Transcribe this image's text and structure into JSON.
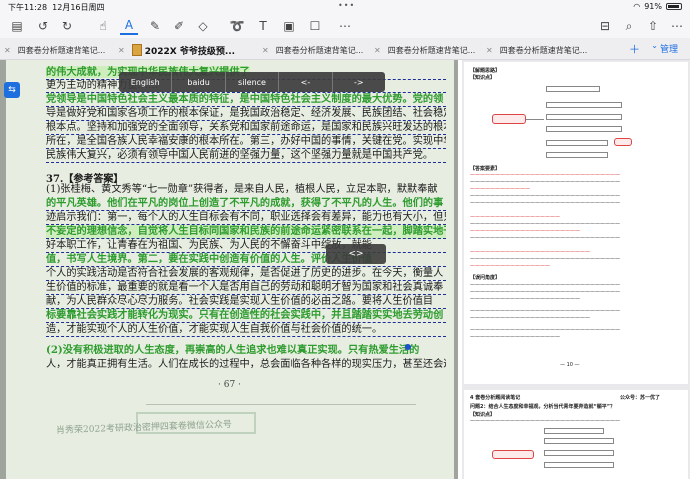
{
  "status": {
    "time": "下午11:28",
    "date": "12月16日周四",
    "battery": "91%"
  },
  "toolbar": {
    "icons": [
      "sidebar-icon",
      "undo-icon",
      "redo-icon",
      "pointer-icon",
      "text-tool-icon",
      "pen-icon",
      "highlighter-icon",
      "eraser-icon",
      "lasso-icon",
      "textbox-icon",
      "image-icon",
      "shape-icon",
      "more-icon",
      "bookmark-icon",
      "search-icon",
      "share-icon",
      "more-menu-icon"
    ]
  },
  "tabs": [
    {
      "label": "四套卷分析题速背笔记..."
    },
    {
      "label": "2022X 爷爷技级预..."
    },
    {
      "label": "四套卷分析题速背笔记..."
    },
    {
      "label": "四套卷分析题速背笔记..."
    },
    {
      "label": "四套卷分析题速背笔记..."
    }
  ],
  "tab_manage": "管理",
  "translate_popup": [
    "English",
    "baidu",
    "silence",
    "<-",
    "->"
  ],
  "toggle_label": "<>",
  "document": {
    "lines": [
      "的伟大成就，为实现中华民族伟大复兴提供了",
      "更为主动的精神力量……",
      "党领导是中国特色社会主义最本质的特征，是中国特色社会主义制度的最大优势。党的领",
      "导是做好党和国家各项工作的根本保证，是我国政治稳定、经济发展、民族团结、社会稳定的",
      "根本点。坚持和加强党的全面领导，关系党和国家前途命运，是国家和民族兴旺发达的根本",
      "所在，是全国各族人民幸福安康的根本所在。第三，办好中国的事情，关键在党。实现中华",
      "民族伟大复兴，必须有领导中国人民前进的坚强力量，这个坚强力量就是中国共产党。"
    ],
    "question": "37.【参考答案】",
    "answer_lines": [
      "(1)张桂梅、黄文秀等“七一勋章”获得者，是来自人民，植根人民，立足本职，默默奉献",
      "的平凡英雄。他们在平凡的岗位上创造了不平凡的成就，获得了不平凡的人生。他们的事",
      "迹启示我们：第一，每个人的人生目标会有不同，职业选择会有差异，能力也有大小，但只要",
      "不妄定的理想信念，自觉将人生目标同国家和民族的前途命运紧密联系在一起，脚踏实地干",
      "好本职工作，让青春在为祖国、为民族、为人民的不懈奋斗中绽放，就能",
      "值，书写人生境界。第二，要在实践中创造有价值的人生。评价人生价值",
      "个人的实践活动是否符合社会发展的客观规律，是否促进了历史的进步。在今天，衡量人",
      "生价值的标准，最重要的就是看一个人是否用自己的劳动和聪明才智为国家和社会真诚奉",
      "献，为人民群众尽心尽力服务。社会实践是实现人生价值的必由之路。要将人生价值目",
      "标要靠社会实践才能转化为现实。只有在创造性的社会实践中，并且踏踏实实地去劳动创",
      "造，才能实现个人的人生价值，才能实现人生自我价值与社会价值的统一。",
      "(2)没有积极进取的人生态度，再崇高的人生追求也难以真正实现。只有热爱生活的",
      "人，才能真正拥有生活。人们在成长的过程中，总会面临各种各样的现实压力，甚至还会遭"
    ],
    "page_number": "· 67 ·",
    "footer_watermark": "肖秀荣2022考研政治密押四套卷微信公众号"
  },
  "right_page": {
    "header": "【解题思路】",
    "section_title": "【知识点】",
    "section2": "【答案要素】",
    "section3": "【误问角度】",
    "page_num": "— 10 —",
    "bottom_header": "4 套卷分析题阅读笔记",
    "bottom_question": "问题2：结合人生态度和幸福观，分析当代青年要弃造就“躺平”？",
    "bottom_note": "公众号：苏一优了",
    "bottom_knowledge": "【知识点】"
  }
}
